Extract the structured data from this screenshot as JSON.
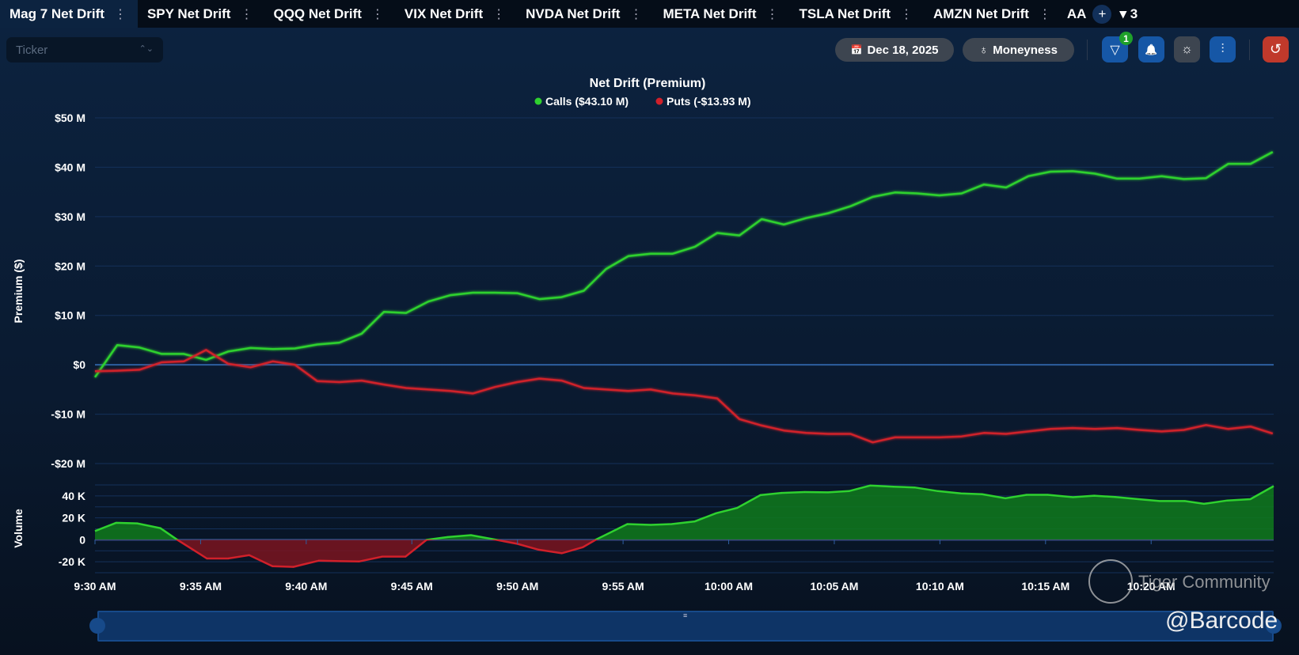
{
  "tabs": [
    {
      "label": "Mag 7 Net Drift",
      "active": true
    },
    {
      "label": "SPY Net Drift"
    },
    {
      "label": "QQQ Net Drift"
    },
    {
      "label": "VIX Net Drift"
    },
    {
      "label": "NVDA Net Drift"
    },
    {
      "label": "META Net Drift"
    },
    {
      "label": "TSLA Net Drift"
    },
    {
      "label": "AMZN Net Drift"
    }
  ],
  "tab_overflow": "AA",
  "tab_add": "+",
  "tab_count": "▾ 3",
  "tab_menu": "⋮",
  "toolbar": {
    "ticker_placeholder": "Ticker",
    "ticker_arrows": "⌃⌄",
    "date": "Dec 18, 2025",
    "date_icon": "📅",
    "moneyness": "Moneyness",
    "moneyness_icon": "♁",
    "filter_badge": "1",
    "filter_icon": "▽",
    "bell_icon": "🔔",
    "bulb_icon": "☼",
    "chart_icon": "⫶",
    "reset_icon": "↺"
  },
  "watermark": {
    "community": "Tiger Community",
    "handle": "@Barcode"
  },
  "slider_grip": "≡",
  "chart_data": [
    {
      "type": "line",
      "title": "Net Drift (Premium)",
      "ylabel": "Premium ($)",
      "ylim": [
        -20,
        50
      ],
      "yticks": [
        {
          "v": 50,
          "label": "$50 M"
        },
        {
          "v": 40,
          "label": "$40 M"
        },
        {
          "v": 30,
          "label": "$30 M"
        },
        {
          "v": 20,
          "label": "$20 M"
        },
        {
          "v": 10,
          "label": "$10 M"
        },
        {
          "v": 0,
          "label": "$0"
        },
        {
          "v": -10,
          "label": "-$10 M"
        },
        {
          "v": -20,
          "label": "-$20 M"
        }
      ],
      "legend": "top-center",
      "x_start_minute": 0,
      "x_step_minutes": 1.052,
      "xlim": [
        0,
        55.8
      ],
      "series": [
        {
          "name": "Calls",
          "legend_label": "Calls ($43.10 M)",
          "color": "#2fd12f",
          "values": [
            -2.5,
            4.0,
            3.5,
            2.2,
            2.2,
            1.0,
            2.7,
            3.4,
            3.2,
            3.3,
            4.1,
            4.5,
            6.3,
            10.7,
            10.5,
            12.8,
            14.1,
            14.6,
            14.6,
            14.5,
            13.3,
            13.7,
            15.0,
            19.4,
            22.0,
            22.5,
            22.5,
            23.9,
            26.7,
            26.2,
            29.5,
            28.4,
            29.7,
            30.7,
            32.1,
            34.0,
            34.9,
            34.7,
            34.3,
            34.7,
            36.5,
            35.9,
            38.2,
            39.1,
            39.2,
            38.7,
            37.7,
            37.7,
            38.2,
            37.6,
            37.8,
            40.7,
            40.7,
            43.1
          ]
        },
        {
          "name": "Puts",
          "legend_label": "Puts (-$13.93 M)",
          "color": "#d0202a",
          "values": [
            -1.3,
            -1.2,
            -1.0,
            0.5,
            0.7,
            3.0,
            0.2,
            -0.5,
            0.7,
            0,
            -3.3,
            -3.5,
            -3.2,
            -4.0,
            -4.7,
            -5.0,
            -5.3,
            -5.8,
            -4.5,
            -3.5,
            -2.8,
            -3.2,
            -4.7,
            -5.0,
            -5.3,
            -5.0,
            -5.8,
            -6.2,
            -6.8,
            -11.0,
            -12.3,
            -13.3,
            -13.8,
            -14.0,
            -14.0,
            -15.7,
            -14.7,
            -14.7,
            -14.7,
            -14.5,
            -13.8,
            -14.0,
            -13.5,
            -13.0,
            -12.8,
            -13.0,
            -12.8,
            -13.2,
            -13.5,
            -13.2,
            -12.2,
            -13.0,
            -12.5,
            -13.93
          ]
        }
      ]
    },
    {
      "type": "area",
      "ylabel": "Volume",
      "ylim": [
        -30,
        50
      ],
      "yticks": [
        {
          "v": 40,
          "label": "40 K"
        },
        {
          "v": 20,
          "label": "20 K"
        },
        {
          "v": 0,
          "label": "0"
        },
        {
          "v": -20,
          "label": "-20 K"
        }
      ],
      "xlim": [
        0,
        55.8
      ],
      "xticks": [
        {
          "v": 0,
          "label": "9:30 AM"
        },
        {
          "v": 5,
          "label": "9:35 AM"
        },
        {
          "v": 10,
          "label": "9:40 AM"
        },
        {
          "v": 15,
          "label": "9:45 AM"
        },
        {
          "v": 20,
          "label": "9:50 AM"
        },
        {
          "v": 25,
          "label": "9:55 AM"
        },
        {
          "v": 30,
          "label": "10:00 AM"
        },
        {
          "v": 35,
          "label": "10:05 AM"
        },
        {
          "v": 40,
          "label": "10:10 AM"
        },
        {
          "v": 45,
          "label": "10:15 AM"
        },
        {
          "v": 50,
          "label": "10:20 AM"
        }
      ],
      "pos_color": "#2fd12f",
      "neg_color": "#d0202a",
      "x": [
        0,
        1,
        2,
        3.1,
        3.9,
        5.3,
        6.3,
        7.3,
        8.4,
        9.4,
        10.6,
        11.6,
        12.5,
        13.6,
        14.7,
        15.7,
        16.7,
        17.8,
        19,
        20,
        21,
        22.1,
        23.1,
        23.7,
        25.2,
        26.3,
        27.3,
        28.4,
        29.4,
        30.4,
        31.5,
        32.5,
        33.6,
        34.7,
        35.7,
        36.7,
        37.8,
        38.8,
        39.9,
        41,
        42,
        43.1,
        44.1,
        45.1,
        46.3,
        47.3,
        48.3,
        49.4,
        50.4,
        51.6,
        52.5,
        53.6,
        54.7,
        55.8
      ],
      "values": [
        8,
        15.5,
        15,
        10.6,
        0,
        -17,
        -17,
        -14,
        -24,
        -24.7,
        -19,
        -19.5,
        -19.8,
        -15.3,
        -15.3,
        0,
        2.5,
        4.2,
        0,
        -3.7,
        -9,
        -12.3,
        -6.7,
        0,
        14.3,
        13.6,
        14.3,
        16.8,
        24.2,
        29,
        40.7,
        42.7,
        43.5,
        43.2,
        44.4,
        49.4,
        48.4,
        47.7,
        44.4,
        42.2,
        41.5,
        37.8,
        41,
        41,
        38.8,
        40.2,
        39,
        37,
        35.3,
        35.3,
        32.8,
        35.8,
        37,
        48.9
      ]
    }
  ]
}
